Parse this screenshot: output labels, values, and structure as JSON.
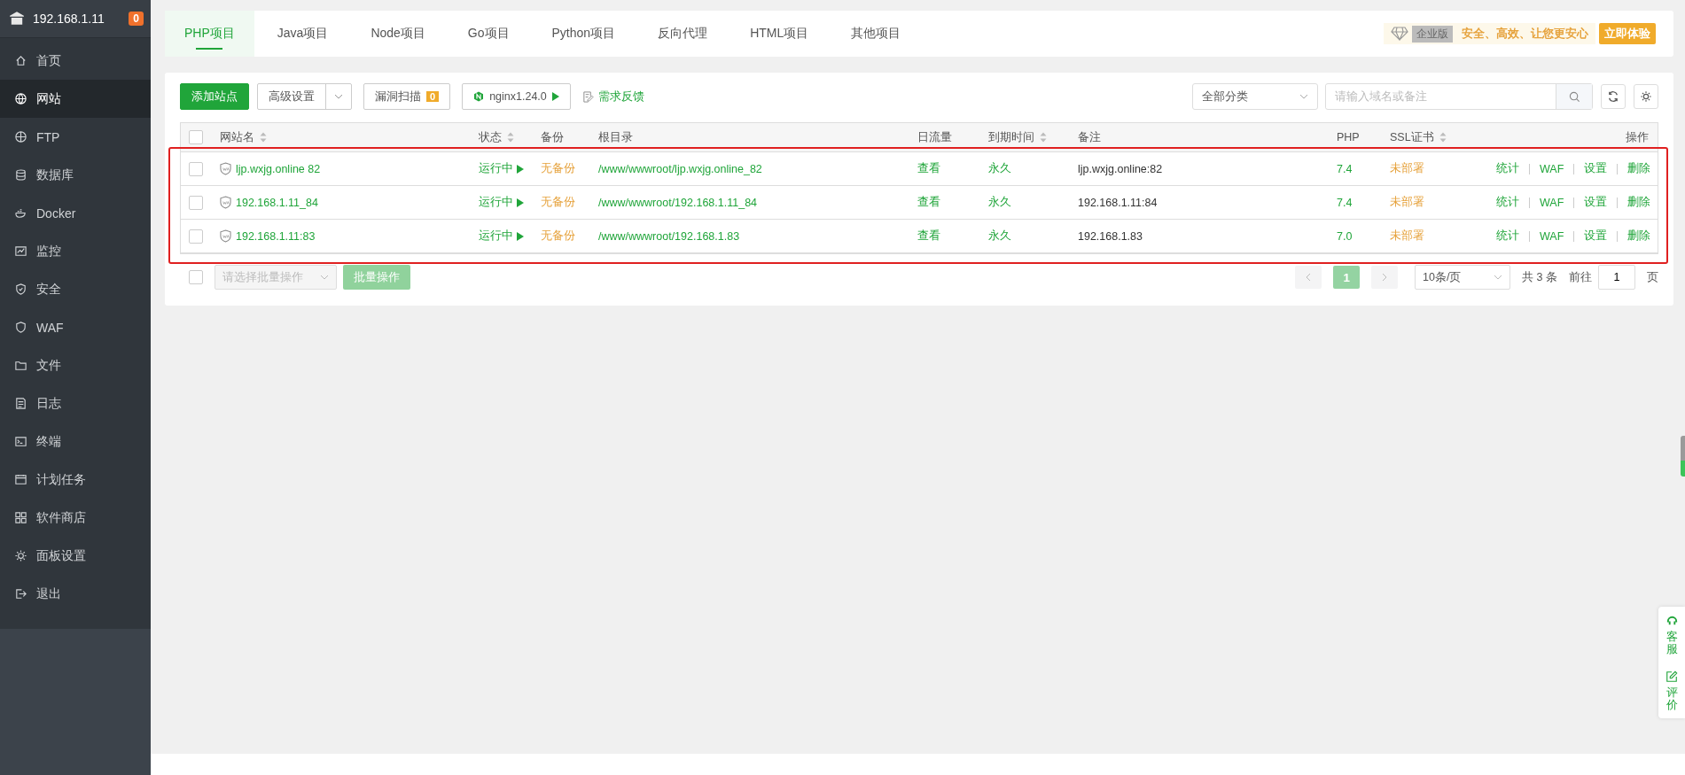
{
  "sidebar": {
    "host": "192.168.1.11",
    "badge": "0",
    "items": [
      {
        "label": "首页",
        "selected": false
      },
      {
        "label": "网站",
        "selected": true
      },
      {
        "label": "FTP",
        "selected": false
      },
      {
        "label": "数据库",
        "selected": false
      },
      {
        "label": "Docker",
        "selected": false
      },
      {
        "label": "监控",
        "selected": false
      },
      {
        "label": "安全",
        "selected": false
      },
      {
        "label": "WAF",
        "selected": false
      },
      {
        "label": "文件",
        "selected": false
      },
      {
        "label": "日志",
        "selected": false
      },
      {
        "label": "终端",
        "selected": false
      },
      {
        "label": "计划任务",
        "selected": false
      },
      {
        "label": "软件商店",
        "selected": false
      },
      {
        "label": "面板设置",
        "selected": false
      },
      {
        "label": "退出",
        "selected": false
      }
    ]
  },
  "tabs": [
    {
      "label": "PHP项目",
      "selected": true
    },
    {
      "label": "Java项目",
      "selected": false
    },
    {
      "label": "Node项目",
      "selected": false
    },
    {
      "label": "Go项目",
      "selected": false
    },
    {
      "label": "Python项目",
      "selected": false
    },
    {
      "label": "反向代理",
      "selected": false
    },
    {
      "label": "HTML项目",
      "selected": false
    },
    {
      "label": "其他项目",
      "selected": false
    }
  ],
  "promo": {
    "edition": "企业版",
    "slogan": "安全、高效、让您更安心",
    "button": "立即体验"
  },
  "toolbar": {
    "add": "添加站点",
    "advanced": "高级设置",
    "scan": "漏洞扫描",
    "scan_count": "0",
    "nginx": "nginx1.24.0",
    "feedback": "需求反馈",
    "category": "全部分类",
    "search_placeholder": "请输入域名或备注"
  },
  "table": {
    "highlighted": true,
    "all_checked": false,
    "columns": [
      {
        "label": "网站名",
        "sortable": true
      },
      {
        "label": "状态",
        "sortable": true
      },
      {
        "label": "备份",
        "sortable": false
      },
      {
        "label": "根目录",
        "sortable": false
      },
      {
        "label": "日流量",
        "sortable": false
      },
      {
        "label": "到期时间",
        "sortable": true
      },
      {
        "label": "备注",
        "sortable": false
      },
      {
        "label": "PHP",
        "sortable": false
      },
      {
        "label": "SSL证书",
        "sortable": true
      },
      {
        "label": "操作",
        "sortable": false
      }
    ],
    "rows": [
      {
        "checked": false,
        "name": "ljp.wxjg.online 82",
        "status": "运行中",
        "backup": "无备份",
        "root": "/www/wwwroot/ljp.wxjg.online_82",
        "traffic": "查看",
        "expiry": "永久",
        "note": "ljp.wxjg.online:82",
        "php": "7.4",
        "ssl": "未部署",
        "actions": [
          "统计",
          "WAF",
          "设置",
          "删除"
        ]
      },
      {
        "checked": false,
        "name": "192.168.1.11_84",
        "status": "运行中",
        "backup": "无备份",
        "root": "/www/wwwroot/192.168.1.11_84",
        "traffic": "查看",
        "expiry": "永久",
        "note": "192.168.1.11:84",
        "php": "7.4",
        "ssl": "未部署",
        "actions": [
          "统计",
          "WAF",
          "设置",
          "删除"
        ]
      },
      {
        "checked": false,
        "name": "192.168.1.11:83",
        "status": "运行中",
        "backup": "无备份",
        "root": "/www/wwwroot/192.168.1.83",
        "traffic": "查看",
        "expiry": "永久",
        "note": "192.168.1.83",
        "php": "7.0",
        "ssl": "未部署",
        "actions": [
          "统计",
          "WAF",
          "设置",
          "删除"
        ]
      }
    ]
  },
  "batch": {
    "checked": false,
    "placeholder": "请选择批量操作",
    "button": "批量操作"
  },
  "pagination": {
    "pages": [
      {
        "label": "1",
        "selected": true
      }
    ],
    "per_page": "10条/页",
    "total": "共 3 条",
    "goto_label": "前往",
    "goto_value": "1",
    "goto_unit": "页"
  },
  "float_panel": [
    "客服",
    "评价"
  ]
}
